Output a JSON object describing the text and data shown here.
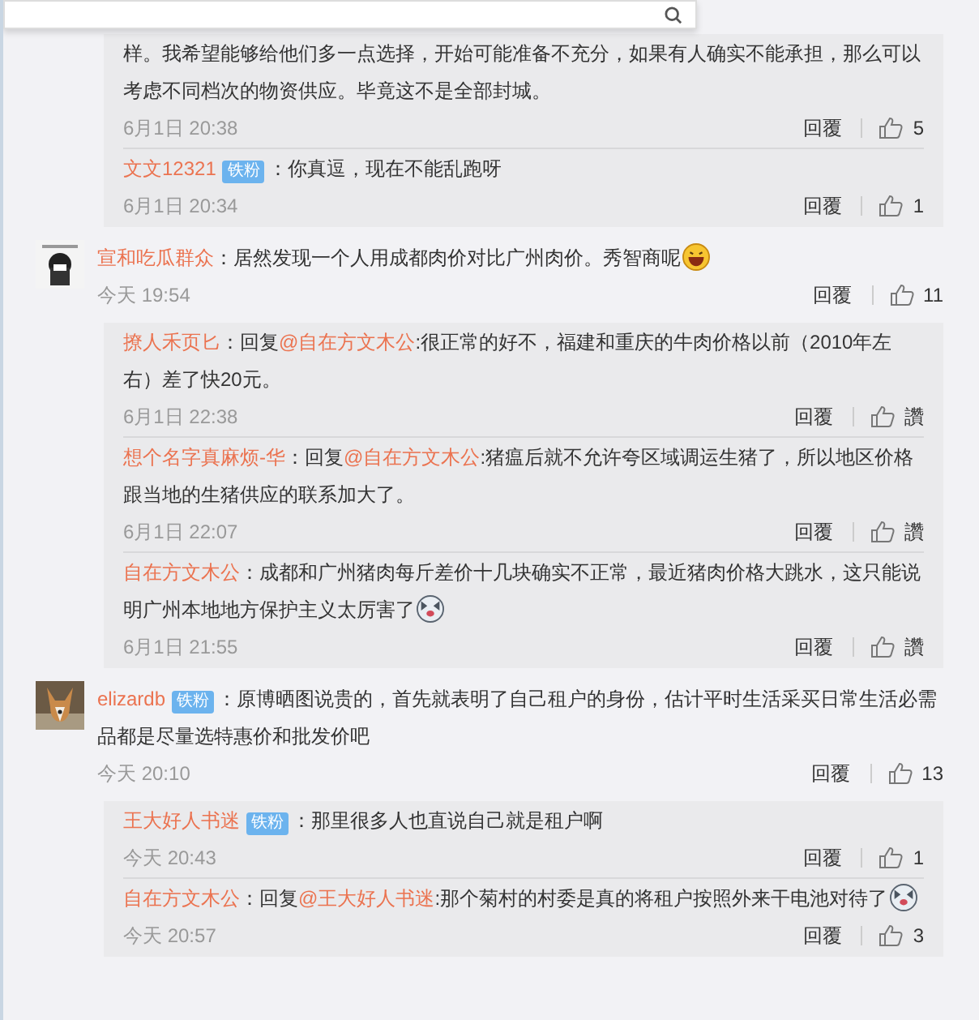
{
  "search_bar": {
    "kind": "field"
  },
  "thread_top": {
    "replies": [
      {
        "text": "样。我希望能够给他们多一点选择，开始可能准备不充分，如果有人确实不能承担，那么可以考虑不同档次的物资供应。毕竟这不是全部封城。",
        "time": "6月1日 20:38",
        "reply_label": "回覆",
        "likes": "5"
      },
      {
        "author": "文文12321",
        "badge": "铁粉",
        "text": "：你真逗，现在不能乱跑呀",
        "time": "6月1日 20:34",
        "reply_label": "回覆",
        "likes": "1"
      }
    ]
  },
  "comments": [
    {
      "author": "宣和吃瓜群众",
      "avatar": {
        "kind": "picture"
      },
      "text": "：居然发现一个人用成都肉价对比广州肉价。秀智商呢",
      "emoji": {
        "kind": "grin"
      },
      "time": "今天 19:54",
      "reply_label": "回覆",
      "likes": "11",
      "replies": [
        {
          "author": "撩人禾页匕",
          "text": "：",
          "prefix": "回复",
          "mention": "@自在方文木公",
          "body": ":很正常的好不，福建和重庆的牛肉价格以前（2010年左右）差了快20元。",
          "time": "6月1日 22:38",
          "reply_label": "回覆",
          "likes": "讚"
        },
        {
          "author": "想个名字真麻烦-华",
          "text": "：",
          "prefix": "回复",
          "mention": "@自在方文木公",
          "body": ":猪瘟后就不允许夸区域调运生猪了，所以地区价格跟当地的生猪供应的联系加大了。",
          "time": "6月1日 22:07",
          "reply_label": "回覆",
          "likes": "讚"
        },
        {
          "author": "自在方文木公",
          "text": "：成都和广州猪肉每斤差价十几块确实不正常，最近猪肉价格大跳水，这只能说明广州本地地方保护主义太厉害了",
          "emoji": {
            "kind": "husky"
          },
          "time": "6月1日 21:55",
          "reply_label": "回覆",
          "likes": "讚"
        }
      ]
    },
    {
      "author": "elizardb",
      "badge": "铁粉",
      "avatar": {
        "kind": "picture"
      },
      "text": "：原博晒图说贵的，首先就表明了自己租户的身份，估计平时生活采买日常生活必需品都是尽量选特惠价和批发价吧",
      "time": "今天 20:10",
      "reply_label": "回覆",
      "likes": "13",
      "replies": [
        {
          "author": "王大好人书迷",
          "badge": "铁粉",
          "text": "：那里很多人也直说自己就是租户啊",
          "time": "今天 20:43",
          "reply_label": "回覆",
          "likes": "1"
        },
        {
          "author": "自在方文木公",
          "text": "：",
          "prefix": "回复",
          "mention": "@王大好人书迷",
          "body": ":那个菊村的村委是真的将租户按照外来干电池对待了",
          "emoji": {
            "kind": "husky"
          },
          "time": "今天 20:57",
          "reply_label": "回覆",
          "likes": "3"
        }
      ]
    }
  ]
}
